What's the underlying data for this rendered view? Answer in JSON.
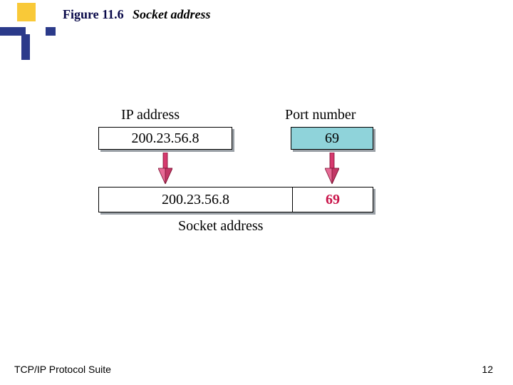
{
  "figure": {
    "label": "Figure 11.6",
    "title": "Socket address"
  },
  "diagram": {
    "ip_label": "IP address",
    "port_label": "Port number",
    "ip_value": "200.23.56.8",
    "port_value": "69",
    "combined_ip": "200.23.56.8",
    "combined_port": "69",
    "result_label": "Socket address"
  },
  "footer": {
    "source": "TCP/IP Protocol Suite",
    "page": "12"
  },
  "colors": {
    "accent_navy": "#2b3a8a",
    "accent_gold": "#f9c938",
    "port_fill": "#8fd3da",
    "arrow_fill": "#d63a6e",
    "highlight_text": "#c9144a"
  }
}
